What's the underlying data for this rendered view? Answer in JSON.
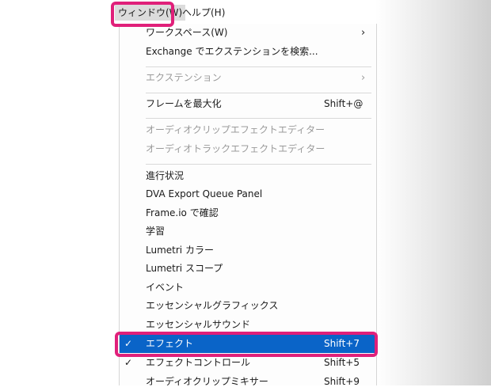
{
  "menubar": {
    "window_label": "ウィンドウ(W)",
    "help_label": "ヘルプ(H)"
  },
  "menu": {
    "workspace": {
      "label": "ワークスペース(W)",
      "arrow": "›"
    },
    "exchange": {
      "label": "Exchange でエクステンションを検索..."
    },
    "extensions": {
      "label": "エクステンション",
      "arrow": "›"
    },
    "maximize_frame": {
      "label": "フレームを最大化",
      "shortcut": "Shift+@"
    },
    "audio_clip_effect_editor": {
      "label": "オーディオクリップエフェクトエディター"
    },
    "audio_track_effect_editor": {
      "label": "オーディオトラックエフェクトエディター"
    },
    "progress": {
      "label": "進行状況"
    },
    "dva_export": {
      "label": "DVA Export Queue Panel"
    },
    "frameio": {
      "label": "Frame.io で確認"
    },
    "learn": {
      "label": "学習"
    },
    "lumetri_color": {
      "label": "Lumetri カラー"
    },
    "lumetri_scopes": {
      "label": "Lumetri スコープ"
    },
    "events": {
      "label": "イベント"
    },
    "essential_graphics": {
      "label": "エッセンシャルグラフィックス"
    },
    "essential_sound": {
      "label": "エッセンシャルサウンド"
    },
    "effects": {
      "label": "エフェクト",
      "shortcut": "Shift+7",
      "check": "✓"
    },
    "effect_controls": {
      "label": "エフェクトコントロール",
      "shortcut": "Shift+5",
      "check": "✓"
    },
    "audio_clip_mixer": {
      "label": "オーディオクリップミキサー",
      "shortcut": "Shift+9"
    }
  },
  "colors": {
    "highlight_border": "#e0207a",
    "selected_background": "#0a64c8"
  }
}
